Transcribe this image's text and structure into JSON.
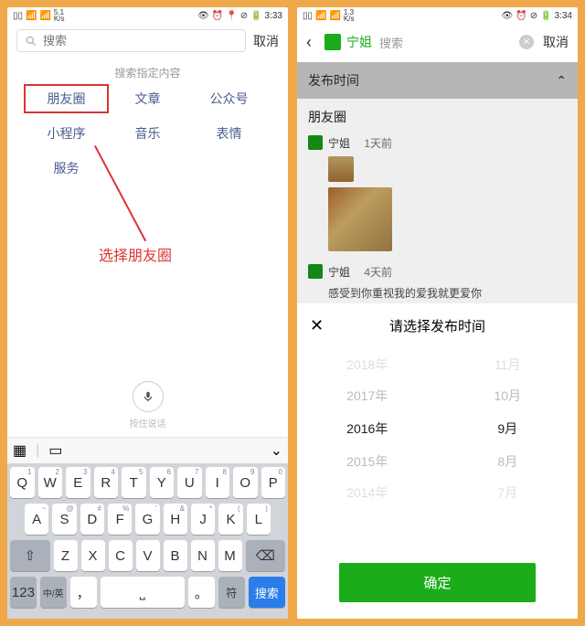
{
  "left": {
    "status": {
      "signal_text": "5.1",
      "kbs": "K/s",
      "time": "3:33"
    },
    "search": {
      "placeholder": "搜索",
      "cancel": "取消"
    },
    "categories_header": "搜索指定内容",
    "categories": [
      "朋友圈",
      "文章",
      "公众号",
      "小程序",
      "音乐",
      "表情",
      "服务"
    ],
    "annotation": "选择朋友圈",
    "mic_hint": "按住说话",
    "keyboard": {
      "row1": [
        {
          "k": "Q",
          "s": "1"
        },
        {
          "k": "W",
          "s": "2"
        },
        {
          "k": "E",
          "s": "3"
        },
        {
          "k": "R",
          "s": "4"
        },
        {
          "k": "T",
          "s": "5"
        },
        {
          "k": "Y",
          "s": "6"
        },
        {
          "k": "U",
          "s": "7"
        },
        {
          "k": "I",
          "s": "8"
        },
        {
          "k": "O",
          "s": "9"
        },
        {
          "k": "P",
          "s": "0"
        }
      ],
      "row2": [
        {
          "k": "A",
          "s": "~"
        },
        {
          "k": "S",
          "s": "@"
        },
        {
          "k": "D",
          "s": "#"
        },
        {
          "k": "F",
          "s": "%"
        },
        {
          "k": "G",
          "s": "'"
        },
        {
          "k": "H",
          "s": "&"
        },
        {
          "k": "J",
          "s": "*"
        },
        {
          "k": "K",
          "s": "("
        },
        {
          "k": "L",
          "s": ")"
        }
      ],
      "row3": [
        "Z",
        "X",
        "C",
        "V",
        "B",
        "N",
        "M"
      ],
      "num_key": "123",
      "lang_key": "中/英",
      "comma": "，",
      "period": "。",
      "sym_key": "符",
      "search_key": "搜索"
    }
  },
  "right": {
    "status": {
      "signal_text": "1.3",
      "kbs": "K/s",
      "time": "3:34"
    },
    "search": {
      "context_name": "宁姐",
      "context_rest": "搜索",
      "cancel": "取消"
    },
    "filter_header": "发布时间",
    "section_title": "朋友圈",
    "posts": [
      {
        "name": "宁姐",
        "time": "1天前"
      },
      {
        "name": "宁姐",
        "time": "4天前",
        "preview": "感受到你重视我的爱我就更爱你"
      }
    ],
    "sheet": {
      "title": "请选择发布时间",
      "years": [
        "2018年",
        "2017年",
        "2016年",
        "2015年",
        "2014年"
      ],
      "months": [
        "11月",
        "10月",
        "9月",
        "8月",
        "7月"
      ],
      "selected_year": "2016年",
      "selected_month": "9月",
      "confirm": "确定"
    }
  }
}
